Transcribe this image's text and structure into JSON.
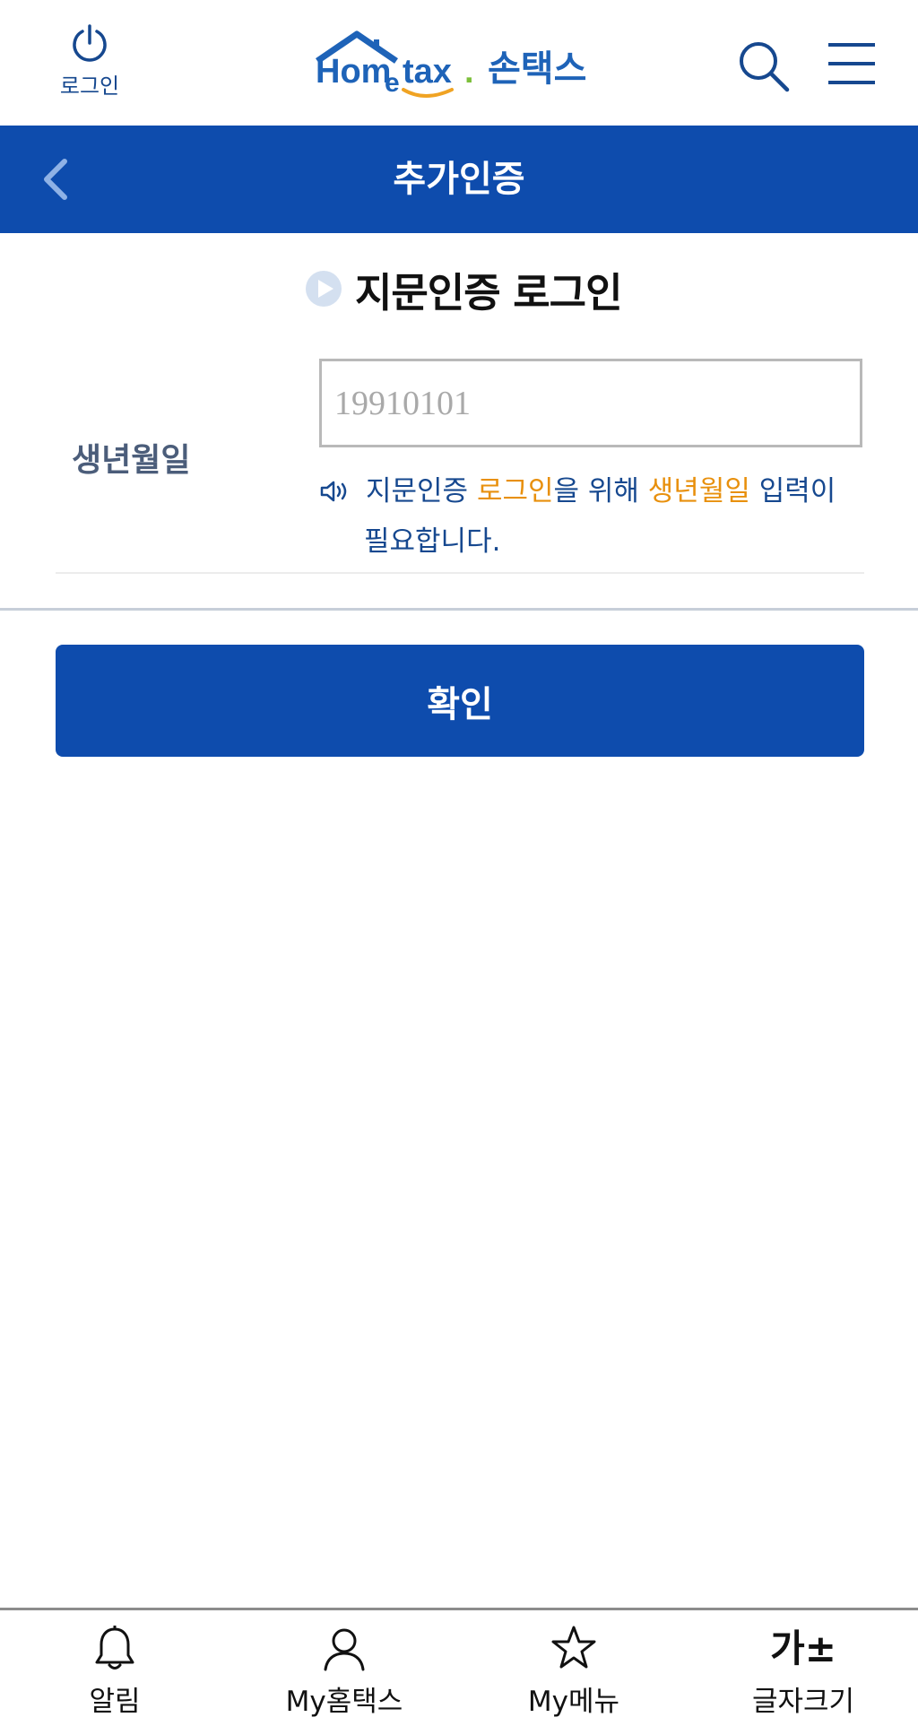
{
  "header": {
    "login_label": "로그인",
    "logo_text_home": "Hom",
    "logo_text_e": "e",
    "logo_text_tax": "tax",
    "logo_dot": ".",
    "logo_korean": "손택스"
  },
  "title_bar": {
    "title": "추가인증"
  },
  "section": {
    "title": "지문인증 로그인"
  },
  "form": {
    "dob_label": "생년월일",
    "dob_placeholder": "19910101",
    "dob_value": "",
    "notice_part1": "지문인증 ",
    "notice_hl1": "로그인",
    "notice_part2": "을 위해  ",
    "notice_hl2": "생년월일",
    "notice_part3": " 입력이",
    "notice_line2": "필요합니다."
  },
  "confirm_label": "확인",
  "bottom_nav": {
    "items": [
      {
        "label": "알림",
        "icon": "bell-icon"
      },
      {
        "label": "My홈택스",
        "icon": "person-icon"
      },
      {
        "label": "My메뉴",
        "icon": "star-icon"
      },
      {
        "label": "글자크기",
        "icon": "font-size-icon",
        "icon_text": "가±"
      }
    ]
  },
  "colors": {
    "brand_blue": "#0e4cad",
    "text_blue": "#16488f",
    "highlight_orange": "#e8900d"
  }
}
